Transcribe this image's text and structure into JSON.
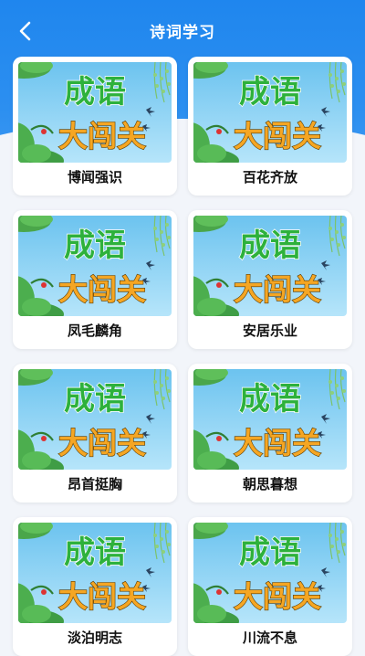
{
  "header": {
    "title": "诗词学习",
    "back_icon": "chevron-left-icon"
  },
  "thumbnail": {
    "line1": "成语",
    "line2": "大闯关",
    "line1_color": "#2db13c",
    "line2_color": "#f5a623",
    "sky_color": "#8fd3f4"
  },
  "items": [
    {
      "label": "博闻强识"
    },
    {
      "label": "百花齐放"
    },
    {
      "label": "凤毛麟角"
    },
    {
      "label": "安居乐业"
    },
    {
      "label": "昂首挺胸"
    },
    {
      "label": "朝思暮想"
    },
    {
      "label": "淡泊明志"
    },
    {
      "label": "川流不息"
    }
  ]
}
